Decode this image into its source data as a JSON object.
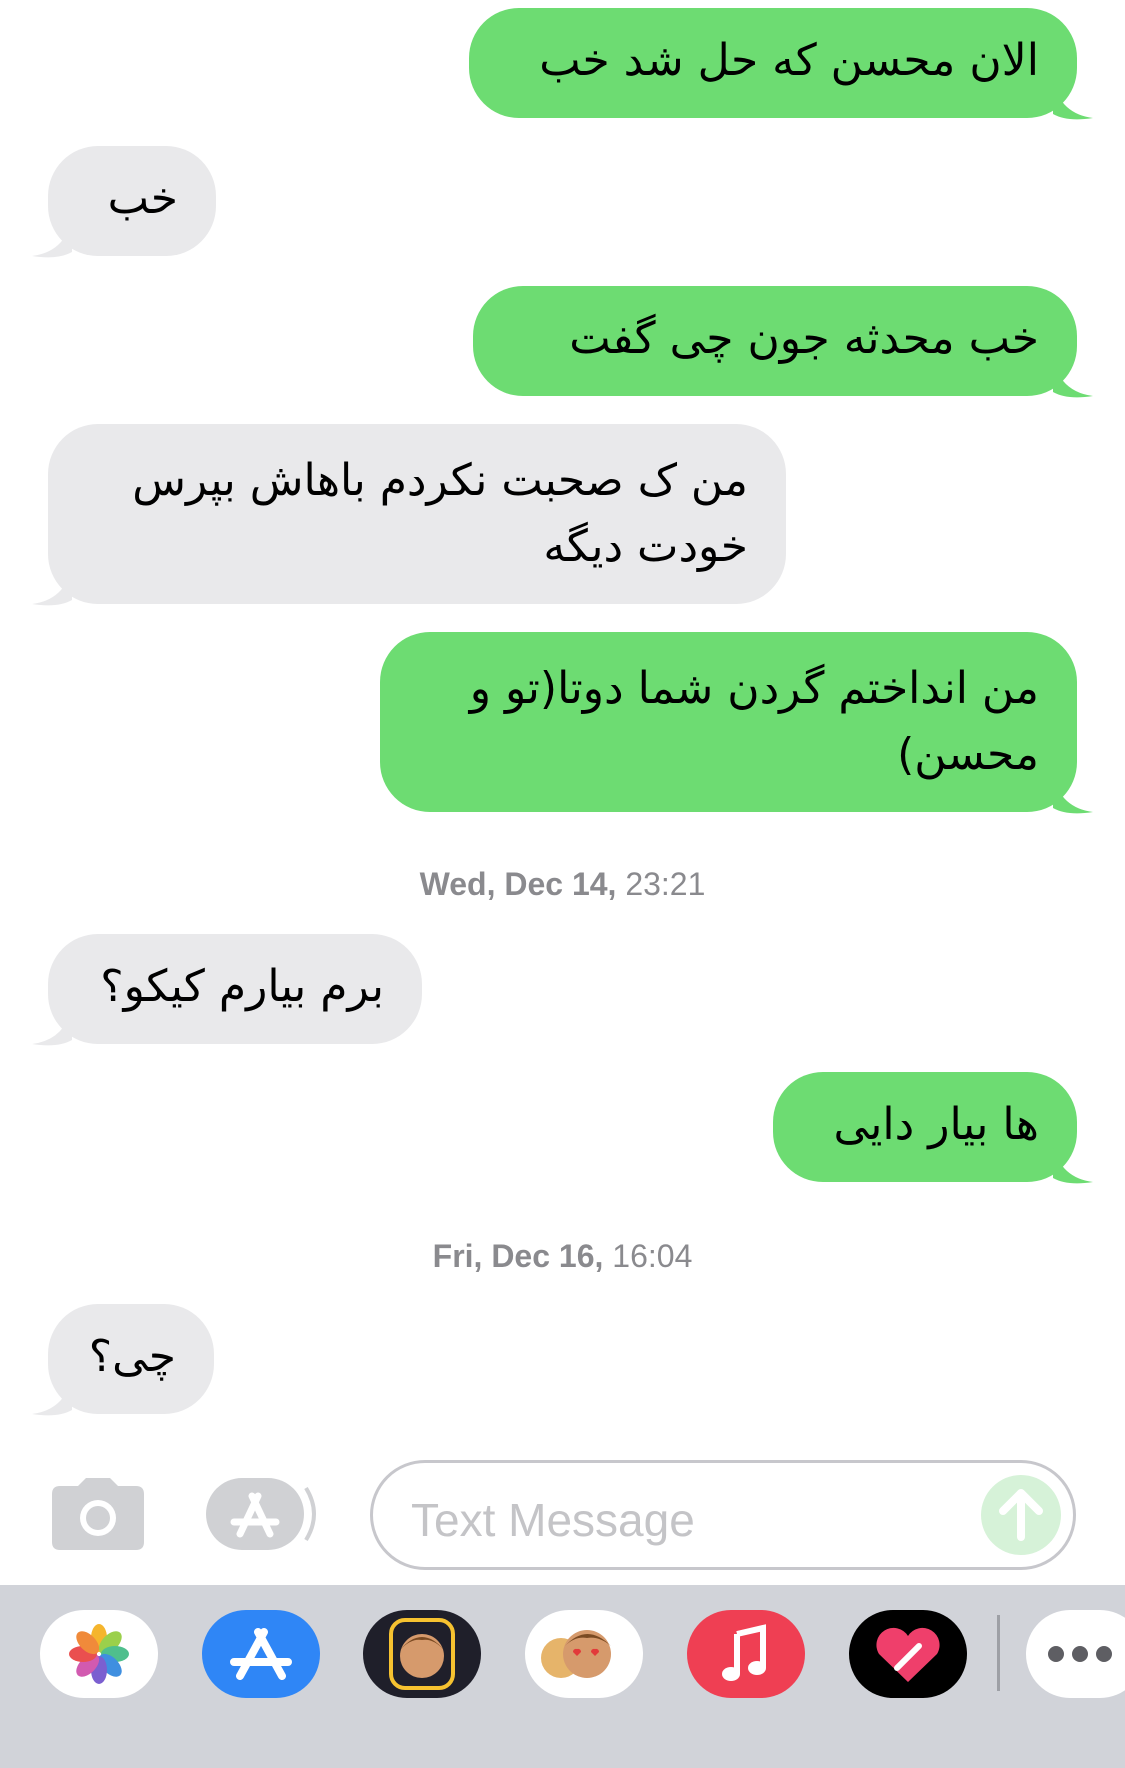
{
  "messages": [
    {
      "dir": "out",
      "text": "الان محسن که حل شد خب"
    },
    {
      "dir": "in",
      "text": "خب"
    },
    {
      "dir": "out",
      "text": "خب محدثه جون چی گفت"
    },
    {
      "dir": "in",
      "text": "من ک صحبت نکردم باهاش بپرس خودت دیگه"
    },
    {
      "dir": "out",
      "text": "من انداختم گردن شما دوتا(تو و محسن)"
    },
    {
      "dir": "in",
      "text": "برم بیارم کیکو؟"
    },
    {
      "dir": "out",
      "text": "ها بیار دایی"
    },
    {
      "dir": "in",
      "text": "چی؟"
    }
  ],
  "timestamps": [
    {
      "day": "Wed, Dec 14,",
      "time": "23:21"
    },
    {
      "day": "Fri, Dec 16,",
      "time": "16:04"
    }
  ],
  "input": {
    "placeholder": "Text Message"
  },
  "colors": {
    "outgoing": "#6ddc72",
    "incoming": "#e9e9eb",
    "drawer": "#d1d3d9"
  },
  "app_drawer": [
    {
      "name": "photos-icon"
    },
    {
      "name": "app-store-icon"
    },
    {
      "name": "memoji-stickers-icon"
    },
    {
      "name": "animoji-icon"
    },
    {
      "name": "music-icon"
    },
    {
      "name": "digital-touch-icon"
    },
    {
      "name": "more-icon"
    }
  ]
}
